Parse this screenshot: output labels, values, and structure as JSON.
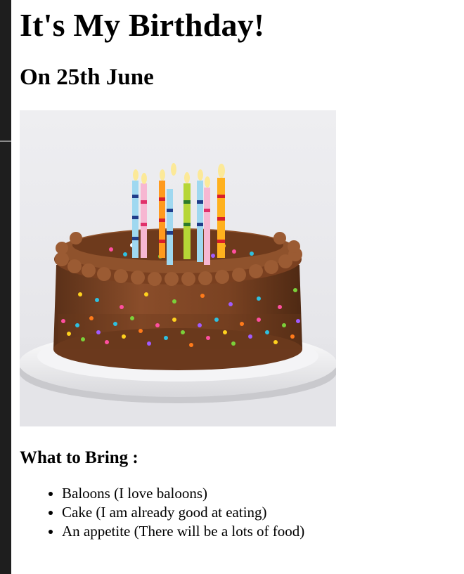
{
  "page": {
    "title": "It's My Birthday!",
    "date": "On 25th June",
    "image_alt": "Chocolate birthday cake with sprinkles and candles",
    "bring_heading": "What to Bring :",
    "bring_items": [
      "Baloons (I love baloons)",
      "Cake (I am already good at eating)",
      "An appetite (There will be a lots of food)"
    ]
  },
  "colors": {
    "sidebar": "#1e1e1e",
    "text": "#000000",
    "background": "#ffffff"
  }
}
